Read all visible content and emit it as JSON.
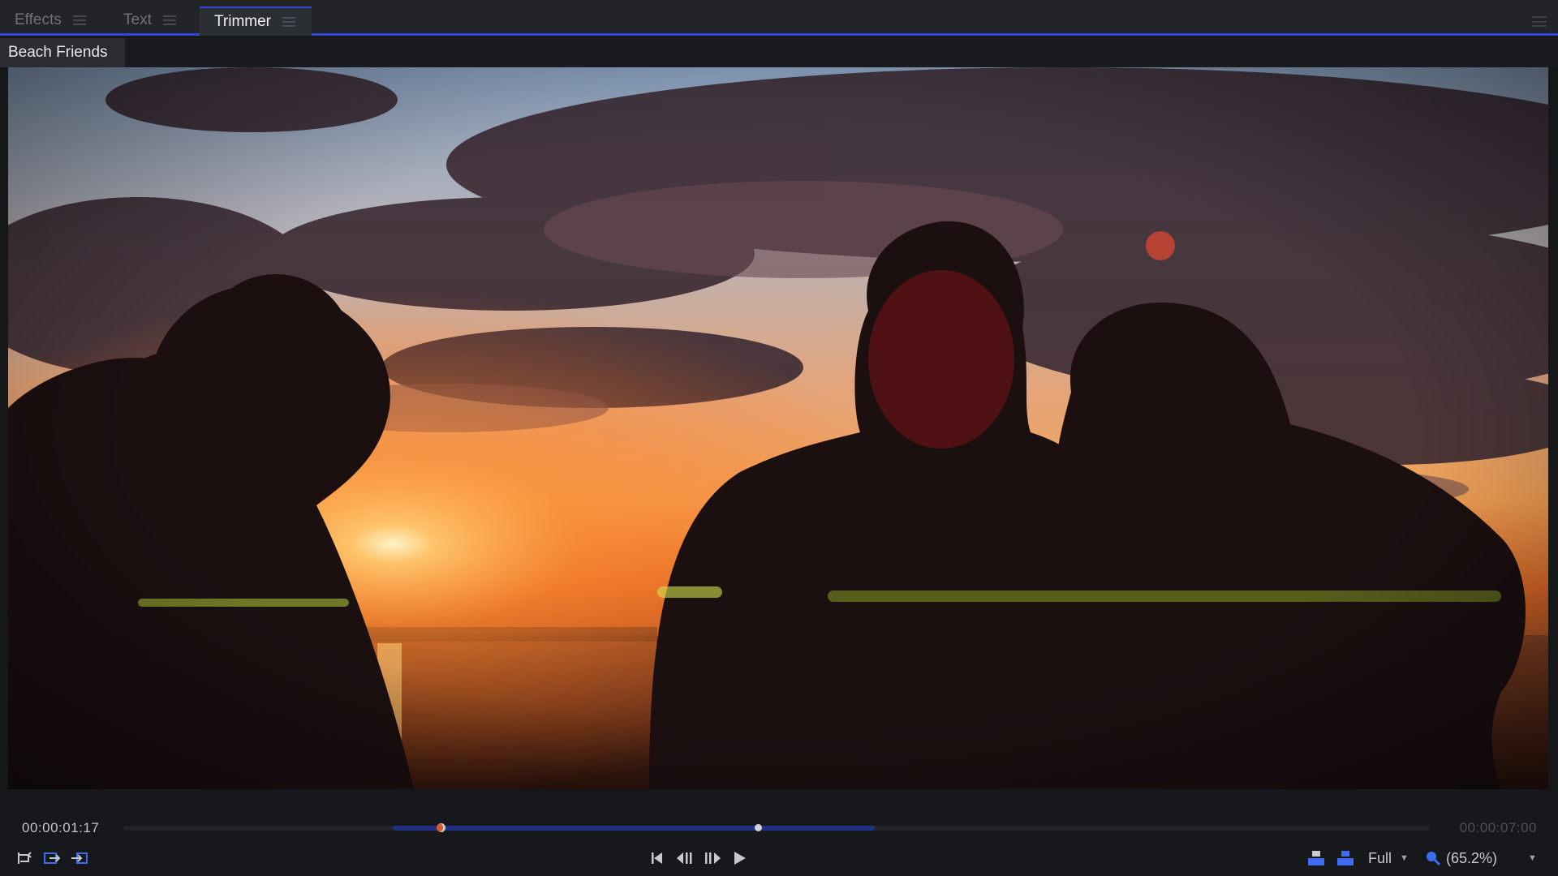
{
  "tabs": [
    {
      "label": "Effects",
      "active": false
    },
    {
      "label": "Text",
      "active": false
    },
    {
      "label": "Trimmer",
      "active": true
    }
  ],
  "clip": {
    "name": "Beach Friends"
  },
  "viewer": {
    "description_icon": "video-frame"
  },
  "transport": {
    "current_timecode": "00:00:01:17",
    "duration_timecode": "00:00:07:00",
    "in_point_fraction": 0.24,
    "playhead_fraction": 0.48,
    "range_start_fraction": 0.205,
    "range_end_fraction": 0.575,
    "quality_label": "Full",
    "zoom_label": "(65.2%)"
  },
  "colors": {
    "accent": "#2f49d6",
    "range": "#223186",
    "in_handle": "#d85a2a"
  },
  "icons": {
    "loop": "loop-icon",
    "mark_in": "mark-in-icon",
    "mark_out": "mark-out-icon",
    "go_start": "skip-to-start-icon",
    "step_back": "step-back-icon",
    "step_forward": "step-forward-icon",
    "play": "play-icon",
    "view_a": "layout-a-icon",
    "view_b": "layout-b-icon",
    "zoom": "magnifier-icon"
  }
}
